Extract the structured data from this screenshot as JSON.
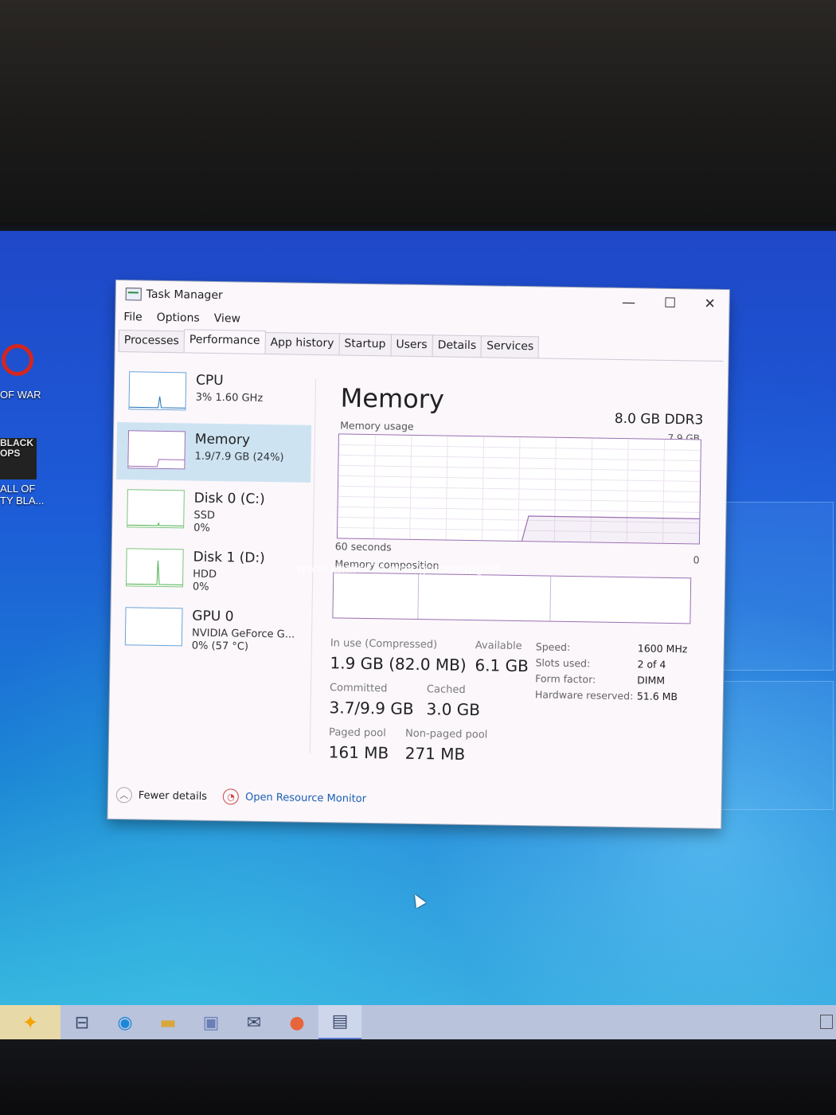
{
  "window": {
    "title": "Task Manager",
    "menu": [
      "File",
      "Options",
      "View"
    ],
    "tabs": [
      "Processes",
      "Performance",
      "App history",
      "Startup",
      "Users",
      "Details",
      "Services"
    ],
    "active_tab": "Performance",
    "minimize": "—",
    "maximize": "☐",
    "close": "✕"
  },
  "sidebar": {
    "items": [
      {
        "name": "CPU",
        "line1": "3%  1.60 GHz",
        "line2": "",
        "line3": ""
      },
      {
        "name": "Memory",
        "line1": "1.9/7.9 GB (24%)",
        "line2": "",
        "line3": ""
      },
      {
        "name": "Disk 0 (C:)",
        "line1": "SSD",
        "line2": "0%",
        "line3": ""
      },
      {
        "name": "Disk 1 (D:)",
        "line1": "HDD",
        "line2": "0%",
        "line3": ""
      },
      {
        "name": "GPU 0",
        "line1": "NVIDIA GeForce G...",
        "line2": "0%  (57 °C)",
        "line3": ""
      }
    ],
    "selected": "Memory"
  },
  "memory": {
    "heading": "Memory",
    "type": "8.0 GB DDR3",
    "usage_label": "Memory usage",
    "max_label": "7.9 GB",
    "time_label": "60 seconds",
    "zero_label": "0",
    "composition_label": "Memory composition",
    "usage_fraction": 0.24,
    "stats": {
      "in_use_label": "In use (Compressed)",
      "in_use_value": "1.9 GB (82.0 MB)",
      "available_label": "Available",
      "available_value": "6.1 GB",
      "committed_label": "Committed",
      "committed_value": "3.7/9.9 GB",
      "cached_label": "Cached",
      "cached_value": "3.0 GB",
      "paged_label": "Paged pool",
      "paged_value": "161 MB",
      "nonpaged_label": "Non-paged pool",
      "nonpaged_value": "271 MB"
    },
    "details": {
      "speed_label": "Speed:",
      "speed_value": "1600 MHz",
      "slots_label": "Slots used:",
      "slots_value": "2 of 4",
      "form_label": "Form factor:",
      "form_value": "DIMM",
      "hw_label": "Hardware reserved:",
      "hw_value": "51.6 MB"
    }
  },
  "footer": {
    "fewer_details": "Fewer details",
    "resource_monitor": "Open Resource Monitor"
  },
  "desktop": {
    "icon1_label": "OF WAR",
    "icon2_label": "ALL OF\nTY BLA...",
    "icon2_logo": "BLACK\nOPS",
    "watermark": "www.khmer24.com/gameming99"
  },
  "colors": {
    "memory_accent": "#9b6fb4",
    "cpu_accent": "#1f6fb4",
    "disk_accent": "#4caf50",
    "selection": "#cde3f2"
  }
}
